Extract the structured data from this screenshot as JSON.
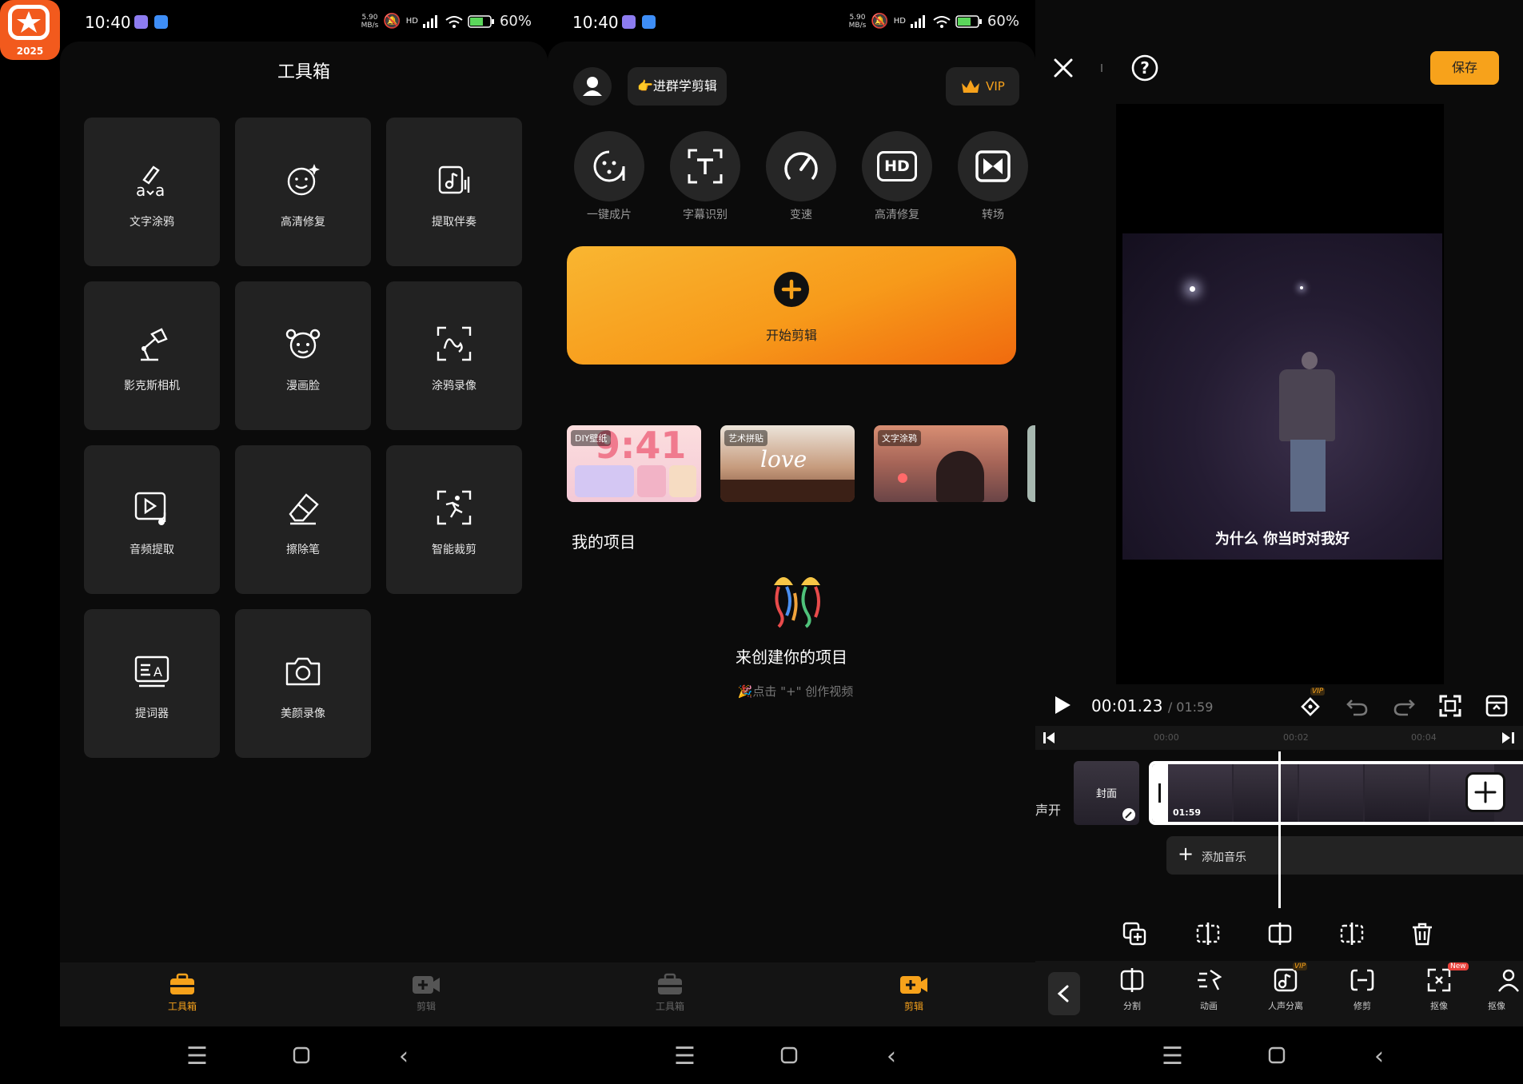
{
  "app_icon": {
    "year": "2025"
  },
  "status_bar": {
    "time": "10:40",
    "speed_top": "5.90",
    "speed_bottom": "MB/s",
    "network": "HD",
    "battery": "60%"
  },
  "toolbox": {
    "title": "工具箱",
    "tools": [
      {
        "label": "文字涂鸦",
        "icon": "text-doodle-icon"
      },
      {
        "label": "高清修复",
        "icon": "face-sparkle-icon"
      },
      {
        "label": "提取伴奏",
        "icon": "music-extract-icon"
      },
      {
        "label": "影克斯相机",
        "icon": "lamp-camera-icon"
      },
      {
        "label": "漫画脸",
        "icon": "cartoon-face-icon"
      },
      {
        "label": "涂鸦录像",
        "icon": "doodle-record-icon"
      },
      {
        "label": "音频提取",
        "icon": "audio-extract-icon"
      },
      {
        "label": "擦除笔",
        "icon": "eraser-icon"
      },
      {
        "label": "智能裁剪",
        "icon": "smart-crop-icon"
      },
      {
        "label": "提词器",
        "icon": "teleprompter-icon"
      },
      {
        "label": "美颜录像",
        "icon": "camera-icon"
      }
    ]
  },
  "bottom_nav": {
    "toolbox": "工具箱",
    "edit": "剪辑"
  },
  "home": {
    "join_group": "👉进群学剪辑",
    "vip": "VIP",
    "quick_tools": [
      "一键成片",
      "字幕识别",
      "变速",
      "高清修复",
      "转场"
    ],
    "hd_badge": "HD",
    "start_label": "开始剪辑",
    "templates": [
      {
        "tag": "DIY壁纸",
        "big": "9:41"
      },
      {
        "tag": "艺术拼贴",
        "big": "love"
      },
      {
        "tag": "文字涂鸦",
        "big": ""
      }
    ],
    "my_projects": "我的项目",
    "empty_title": "来创建你的项目",
    "empty_hint": "🎉点击 \"+\" 创作视频"
  },
  "editor": {
    "save": "保存",
    "subtitle": "为什么 你当时对我好",
    "current_time": "00:01.23",
    "total_time": "/ 01:59",
    "vip_badge": "VIP",
    "ruler": [
      "00:00",
      "00:02",
      "00:04"
    ],
    "cover_label": "封面",
    "side_label": "声开",
    "clip_duration": "01:59",
    "add_music": "添加音乐",
    "tools": [
      "分割",
      "动画",
      "人声分离",
      "修剪",
      "抠像",
      "抠像"
    ],
    "new_badge": "New"
  },
  "colors": {
    "accent": "#f7a21b",
    "panel": "#0b0b0b",
    "tile": "#222222"
  }
}
